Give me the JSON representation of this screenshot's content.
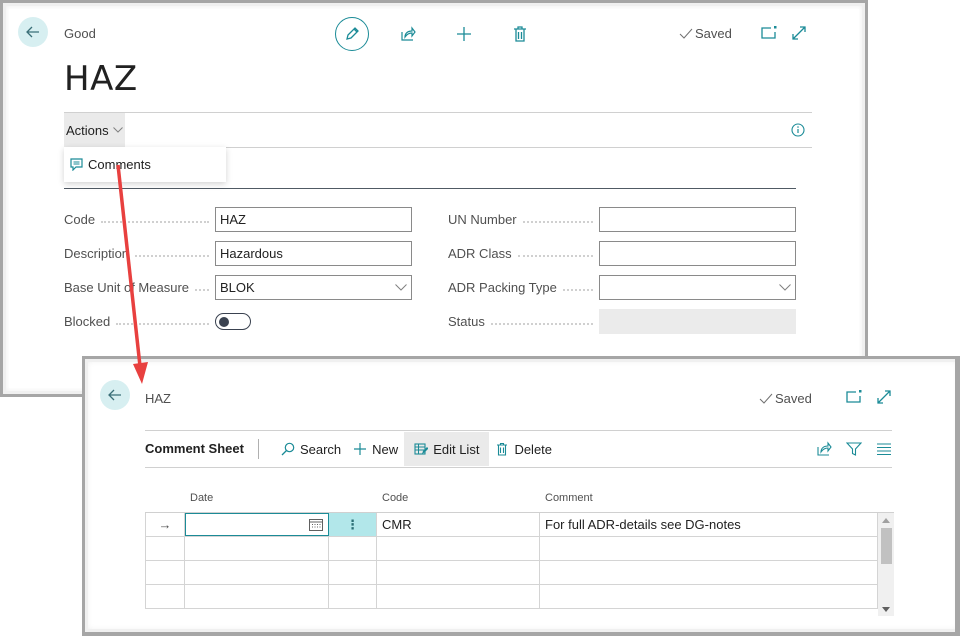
{
  "card_window": {
    "caption": "Good",
    "title": "HAZ",
    "saved_label": "Saved",
    "actions_label": "Actions",
    "dropdown_items": [
      {
        "label": "Comments",
        "icon": "comment-icon"
      }
    ],
    "fields_left": [
      {
        "label": "Code",
        "value": "HAZ",
        "type": "text"
      },
      {
        "label": "Description",
        "value": "Hazardous",
        "type": "text"
      },
      {
        "label": "Base Unit of Measure",
        "value": "BLOK",
        "type": "select"
      },
      {
        "label": "Blocked",
        "value": "off",
        "type": "toggle"
      }
    ],
    "fields_right": [
      {
        "label": "UN Number",
        "value": "",
        "type": "text"
      },
      {
        "label": "ADR Class",
        "value": "",
        "type": "text"
      },
      {
        "label": "ADR Packing Type",
        "value": "",
        "type": "select"
      },
      {
        "label": "Status",
        "value": "",
        "type": "readonly"
      }
    ]
  },
  "comment_window": {
    "caption": "HAZ",
    "saved_label": "Saved",
    "sheet_title": "Comment Sheet",
    "actions": {
      "search": "Search",
      "new": "New",
      "edit_list": "Edit List",
      "delete": "Delete"
    },
    "columns": [
      "Date",
      "Code",
      "Comment"
    ],
    "rows": [
      {
        "date": "",
        "code": "CMR",
        "comment": "For full ADR-details see DG-notes"
      },
      {
        "date": "",
        "code": "",
        "comment": ""
      },
      {
        "date": "",
        "code": "",
        "comment": ""
      },
      {
        "date": "",
        "code": "",
        "comment": ""
      }
    ]
  },
  "colors": {
    "accent": "#1b8b97",
    "back_button_bg": "#d7eff1",
    "annotation_arrow": "#e8403f"
  }
}
